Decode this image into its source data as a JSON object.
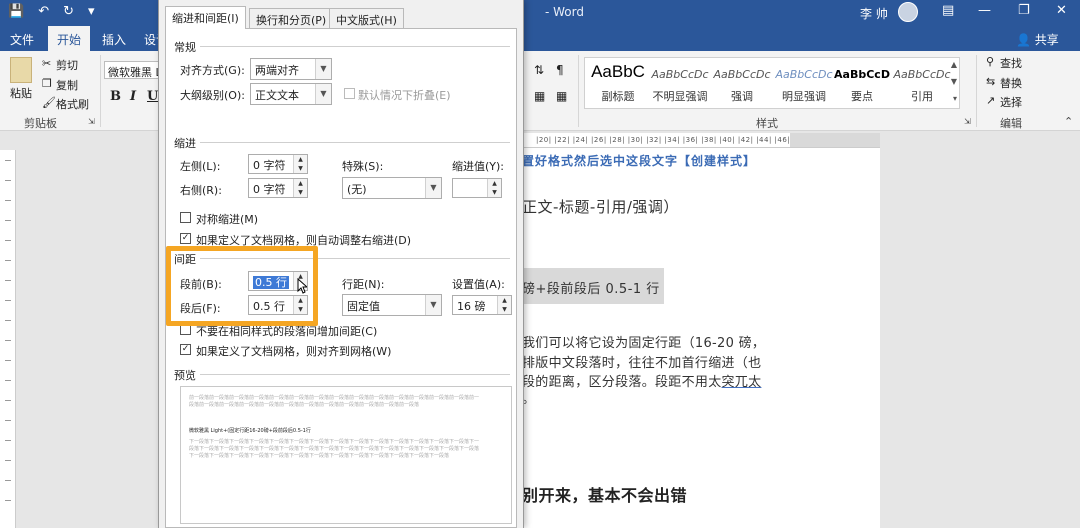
{
  "window": {
    "title": "- Word",
    "user_name": "李 帅",
    "share_label": "共享"
  },
  "ribbon_tabs": [
    "文件",
    "开始",
    "插入",
    "设计"
  ],
  "ribbon": {
    "clipboard": {
      "paste": "粘贴",
      "cut": "剪切",
      "copy": "复制",
      "format_painter": "格式刷",
      "group": "剪贴板"
    },
    "font_name": "微软雅黑 Li",
    "format_buttons": [
      "B",
      "I",
      "U"
    ],
    "styles": [
      {
        "sample": "AaBbC",
        "name": "副标题"
      },
      {
        "sample": "AaBbCcDc",
        "name": "不明显强调"
      },
      {
        "sample": "AaBbCcDc",
        "name": "强调"
      },
      {
        "sample": "AaBbCcDc",
        "name": "明显强调"
      },
      {
        "sample": "AaBbCcD",
        "name": "要点"
      },
      {
        "sample": "AaBbCcDc",
        "name": "引用"
      }
    ],
    "styles_group": "样式",
    "editing": {
      "find": "查找",
      "replace": "替换",
      "select": "选择",
      "group": "编辑"
    }
  },
  "ruler_marks": "|20| |22| |24| |26| |28| |30| |32| |34| |36| |38| |40| |42| |44| |46| |48|",
  "document": {
    "line1": "置好格式然后选中这段文字【创建样式】",
    "line2": "正文-标题-引用/强调）",
    "box_text": "磅+段前段后 0.5-1 行",
    "para1": "我们可以将它设为固定行距（16-20 磅，",
    "para2": "排版中文段落时，往往不加首行缩进（也",
    "para3_a": "段的距离，区分段落。段距不用太",
    "para3_b": "突兀太",
    "para4": "。",
    "bold_line": "别开来，基本不会出错"
  },
  "dialog": {
    "tabs": [
      "缩进和间距(I)",
      "换行和分页(P)",
      "中文版式(H)"
    ],
    "general": {
      "section": "常规",
      "alignment_label": "对齐方式(G):",
      "alignment_value": "两端对齐",
      "outline_label": "大纲级别(O):",
      "outline_value": "正文文本",
      "collapsed_label": "默认情况下折叠(E)"
    },
    "indent": {
      "section": "缩进",
      "left_label": "左侧(L):",
      "left_value": "0 字符",
      "right_label": "右侧(R):",
      "right_value": "0 字符",
      "special_label": "特殊(S):",
      "special_value": "(无)",
      "by_label": "缩进值(Y):",
      "by_value": "",
      "mirror_label": "对称缩进(M)",
      "auto_adjust_label": "如果定义了文档网格，则自动调整右缩进(D)"
    },
    "spacing": {
      "section": "间距",
      "before_label": "段前(B):",
      "before_value": "0.5 行",
      "after_label": "段后(F):",
      "after_value": "0.5 行",
      "line_label": "行距(N):",
      "line_value": "固定值",
      "at_label": "设置值(A):",
      "at_value": "16 磅",
      "no_space_label": "不要在相同样式的段落间增加间距(C)",
      "snap_grid_label": "如果定义了文档网格，则对齐到网格(W)"
    },
    "preview": {
      "section": "预览",
      "prev_text": "前一段落前一段落前一段落前一段落前一段落前一段落前一段落前一段落前一段落前一段落前一段落前一段落前一段落前一段落前一段落前一段落前一段落前一段落前一段落前一段落前一段落前一段落前一段落前一段落前一段落前一段落",
      "sample_text": "微软雅黑 Light+(固定行距16-20磅+段前段后0.5-1行",
      "next_text": "下一段落下一段落下一段落下一段落下一段落下一段落下一段落下一段落下一段落下一段落下一段落下一段落下一段落下一段落下一段落下一段落下一段落下一段落下一段落下一段落下一段落下一段落下一段落下一段落下一段落下一段落下一段落下一段落下一段落下一段落下一段落下一段落下一段落下一段落下一段落下一段落下一段落下一段落下一段落下一段落下一段落下一段落"
    }
  },
  "colors": {
    "word_blue": "#2b579a",
    "highlight_orange": "#f5a623",
    "heading_blue": "#3b6bb5"
  }
}
